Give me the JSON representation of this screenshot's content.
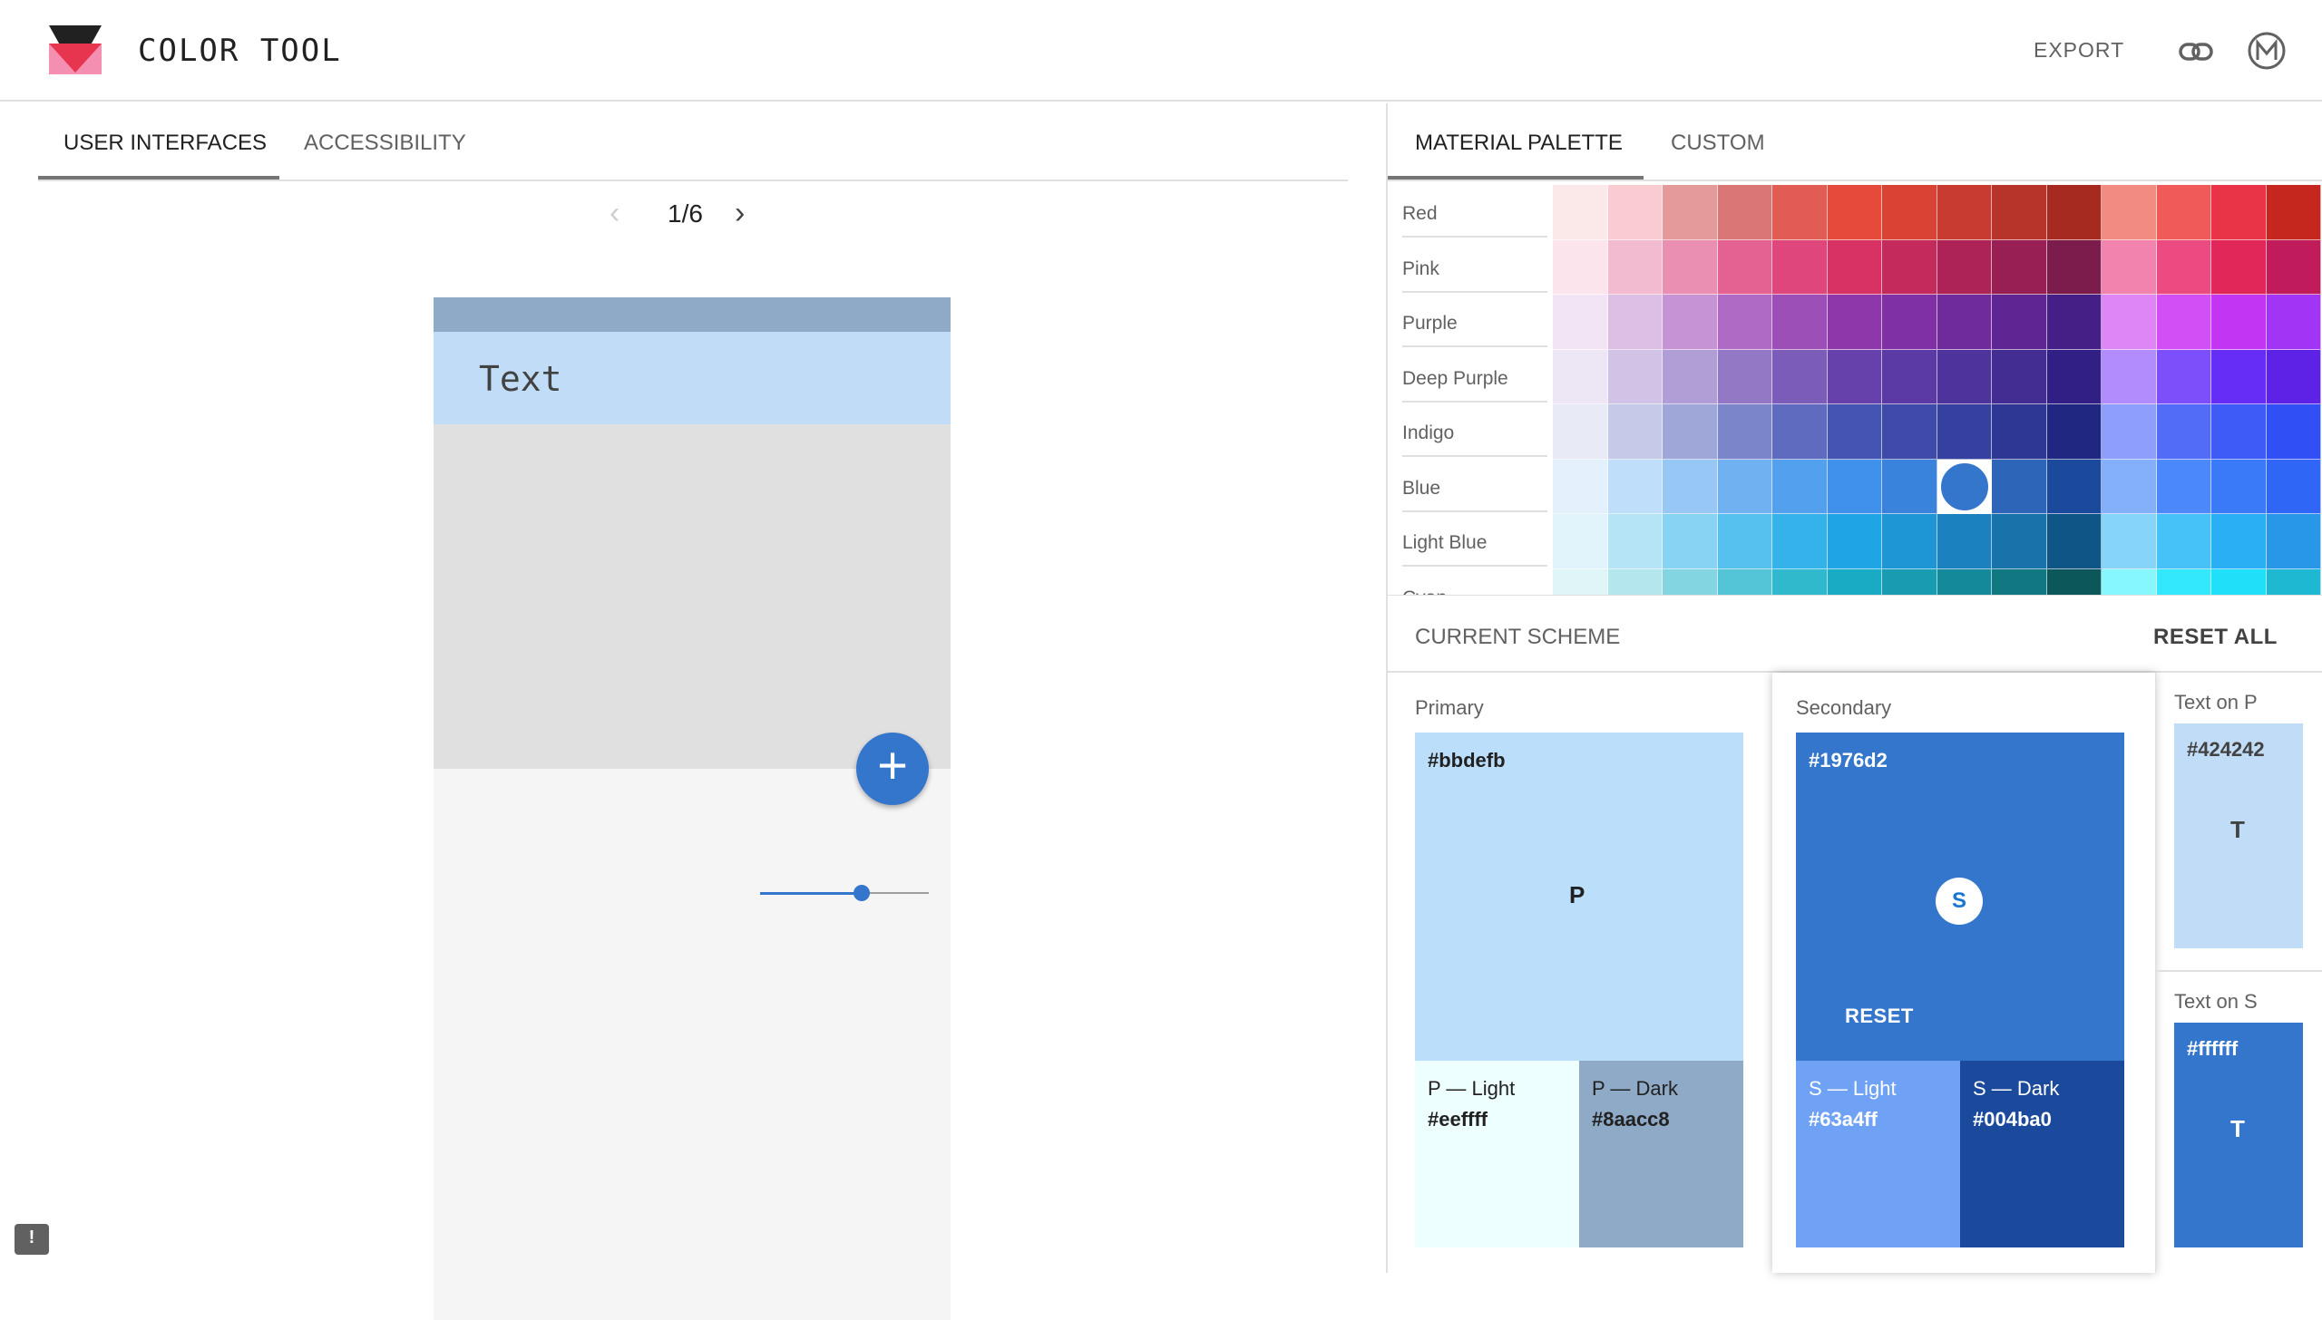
{
  "header": {
    "title": "COLOR TOOL",
    "export_label": "EXPORT",
    "icons": [
      "logo",
      "link-icon",
      "material-icon"
    ]
  },
  "left": {
    "tabs": [
      {
        "label": "USER INTERFACES",
        "active": true
      },
      {
        "label": "ACCESSIBILITY",
        "active": false
      }
    ],
    "pager": {
      "label": "1/6",
      "prev_icon": "chevron-left-icon",
      "next_icon": "chevron-right-icon"
    },
    "phone": {
      "appbar_text": "Text",
      "fab_icon": "+",
      "slider_value": 0.6,
      "colors": {
        "status": "#8eaac6",
        "appbar": "#c1dcf6",
        "hero": "#e0e0e0",
        "body": "#f5f5f5",
        "accent": "#3476cc"
      }
    },
    "feedback_icon": "!"
  },
  "right": {
    "tabs": [
      {
        "label": "MATERIAL PALETTE",
        "active": true
      },
      {
        "label": "CUSTOM",
        "active": false
      }
    ],
    "palette": {
      "rows": [
        {
          "name": "Red",
          "shades": [
            "#fbe9ea",
            "#f8ccd1",
            "#e49a9a",
            "#d97676",
            "#e05c54",
            "#e64a3b",
            "#d84334",
            "#c83b30",
            "#b7342b",
            "#a72a20",
            "#f28c80",
            "#f05a58",
            "#e83446",
            "#c5271e"
          ]
        },
        {
          "name": "Pink",
          "shades": [
            "#fbe4ec",
            "#f2bbd0",
            "#ea8fb2",
            "#e36292",
            "#de467c",
            "#d83163",
            "#c52a5d",
            "#ae2357",
            "#981f53",
            "#7b1c4d",
            "#f283ae",
            "#ec4b82",
            "#e12659",
            "#c01c5b"
          ]
        },
        {
          "name": "Purple",
          "shades": [
            "#f2e4f4",
            "#ddbfe5",
            "#c694d5",
            "#ae6ac4",
            "#9d4fb8",
            "#8e37ab",
            "#8030a5",
            "#6f2a9c",
            "#5f2593",
            "#451e86",
            "#de86f5",
            "#d14ff5",
            "#c235f2",
            "#a234f6"
          ]
        },
        {
          "name": "Deep Purple",
          "shades": [
            "#ede6f4",
            "#d1c3e6",
            "#b19ed6",
            "#9378c5",
            "#7c5cb9",
            "#6640ab",
            "#5b3aa5",
            "#4e339c",
            "#432d93",
            "#311f86",
            "#b28bfc",
            "#7d4ffb",
            "#662df6",
            "#5d22e6"
          ]
        },
        {
          "name": "Indigo",
          "shades": [
            "#e8eaf5",
            "#c5cae8",
            "#9fa7d9",
            "#7a85ca",
            "#5f6bbf",
            "#4554b3",
            "#3f4ba9",
            "#36419f",
            "#2f3794",
            "#1f2780",
            "#8d9efd",
            "#536cf8",
            "#3e5af7",
            "#3050f5"
          ]
        },
        {
          "name": "Blue",
          "shades": [
            "#e4f1fc",
            "#bfdef9",
            "#97c8f5",
            "#6fb1f1",
            "#53a0ef",
            "#3f91ec",
            "#3a83dc",
            "#3476cc",
            "#2d65b9",
            "#1b4a9c",
            "#84b0fb",
            "#4b89fa",
            "#3a7af9",
            "#3066f6"
          ]
        },
        {
          "name": "Light Blue",
          "shades": [
            "#e2f4fb",
            "#b6e4f7",
            "#86d3f3",
            "#56c1ee",
            "#33b3ea",
            "#1fa5e6",
            "#1e95d5",
            "#1b82bf",
            "#1773aa",
            "#0f5687",
            "#87d4f9",
            "#47c2f8",
            "#2aaff5",
            "#2897e8"
          ]
        },
        {
          "name": "Cyan",
          "shades": [
            "#e0f5f8",
            "#b4e6ee",
            "#84d5e2",
            "#54c5d6",
            "#30b8cd",
            "#19abc4",
            "#179cb2",
            "#148999",
            "#117781",
            "#0b575a",
            "#86f7fd",
            "#33e8fb",
            "#20dff9",
            "#1eb8d3"
          ]
        }
      ],
      "selected": {
        "row": "Blue",
        "shade_index": 7
      }
    },
    "scheme": {
      "title": "CURRENT SCHEME",
      "reset_all": "RESET ALL",
      "primary": {
        "label": "Primary",
        "hex": "#bbdefb",
        "letter": "P",
        "light": {
          "label": "P — Light",
          "hex": "#eeffff"
        },
        "dark": {
          "label": "P — Dark",
          "hex": "#8aacc8"
        }
      },
      "secondary": {
        "label": "Secondary",
        "hex": "#1976d2",
        "letter": "S",
        "reset": "RESET",
        "light": {
          "label": "S — Light",
          "hex": "#63a4ff"
        },
        "dark": {
          "label": "S — Dark",
          "hex": "#004ba0"
        }
      },
      "text_on_p": {
        "label": "Text on P",
        "hex": "#424242",
        "letter": "T"
      },
      "text_on_s": {
        "label": "Text on S",
        "hex": "#ffffff",
        "letter": "T"
      }
    }
  }
}
